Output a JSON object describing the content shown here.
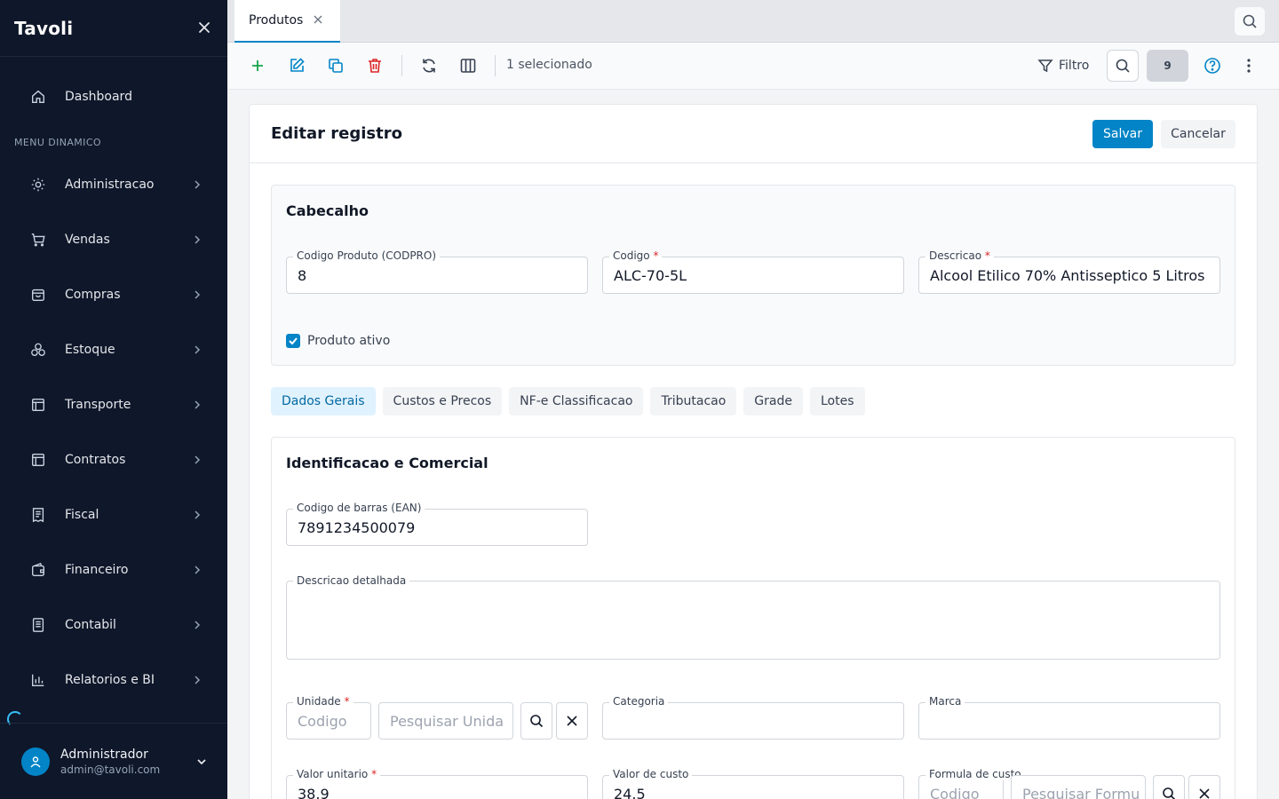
{
  "sidebar": {
    "brand": "Tavoli",
    "close_icon": "close-icon",
    "section_label": "MENU DINAMICO",
    "items": [
      {
        "label": "Dashboard",
        "icon": "home-icon"
      },
      {
        "label": "Administracao",
        "icon": "gear-icon"
      },
      {
        "label": "Vendas",
        "icon": "cart-icon"
      },
      {
        "label": "Compras",
        "icon": "bag-icon"
      },
      {
        "label": "Estoque",
        "icon": "boxes-icon"
      },
      {
        "label": "Transporte",
        "icon": "layout-icon"
      },
      {
        "label": "Contratos",
        "icon": "layout-icon"
      },
      {
        "label": "Fiscal",
        "icon": "receipt-icon"
      },
      {
        "label": "Financeiro",
        "icon": "wallet-icon"
      },
      {
        "label": "Contabil",
        "icon": "book-icon"
      },
      {
        "label": "Relatorios e BI",
        "icon": "bar-chart-icon"
      }
    ],
    "user": {
      "name": "Administrador",
      "email": "admin@tavoli.com"
    }
  },
  "tabbar": {
    "tabs": [
      {
        "label": "Produtos",
        "active": true
      }
    ]
  },
  "toolbar": {
    "selection_text": "1 selecionado",
    "filter_label": "Filtro",
    "count": "9"
  },
  "form": {
    "title": "Editar registro",
    "save_label": "Salvar",
    "cancel_label": "Cancelar",
    "header_section": {
      "title": "Cabecalho",
      "codpro": {
        "label": "Codigo Produto (CODPRO)",
        "value": "8"
      },
      "codigo": {
        "label": "Codigo",
        "value": "ALC-70-5L",
        "required": true
      },
      "descricao": {
        "label": "Descricao",
        "value": "Alcool Etilico 70% Antisseptico 5 Litros",
        "required": true
      },
      "ativo": {
        "label": "Produto ativo",
        "checked": true
      }
    },
    "tabs": [
      "Dados Gerais",
      "Custos e Precos",
      "NF-e Classificacao",
      "Tributacao",
      "Grade",
      "Lotes"
    ],
    "active_tab": "Dados Gerais",
    "section": {
      "title": "Identificacao e Comercial",
      "ean": {
        "label": "Codigo de barras (EAN)",
        "value": "7891234500079"
      },
      "descricao_detalhada": {
        "label": "Descricao detalhada",
        "value": ""
      },
      "unidade": {
        "label": "Unidade",
        "code_placeholder": "Codigo",
        "search_placeholder": "Pesquisar Unida",
        "required": true
      },
      "categoria": {
        "label": "Categoria",
        "value": ""
      },
      "marca": {
        "label": "Marca",
        "value": ""
      },
      "valor_unitario": {
        "label": "Valor unitario",
        "value": "38.9",
        "required": true
      },
      "valor_custo": {
        "label": "Valor de custo",
        "value": "24.5"
      },
      "formula_custo": {
        "label": "Formula de custo",
        "code_placeholder": "Codigo",
        "search_placeholder": "Pesquisar Formu"
      }
    }
  },
  "colors": {
    "sidebar_bg": "#0f172a",
    "accent": "#0284c7",
    "danger": "#dc2626",
    "add": "#16a34a"
  }
}
